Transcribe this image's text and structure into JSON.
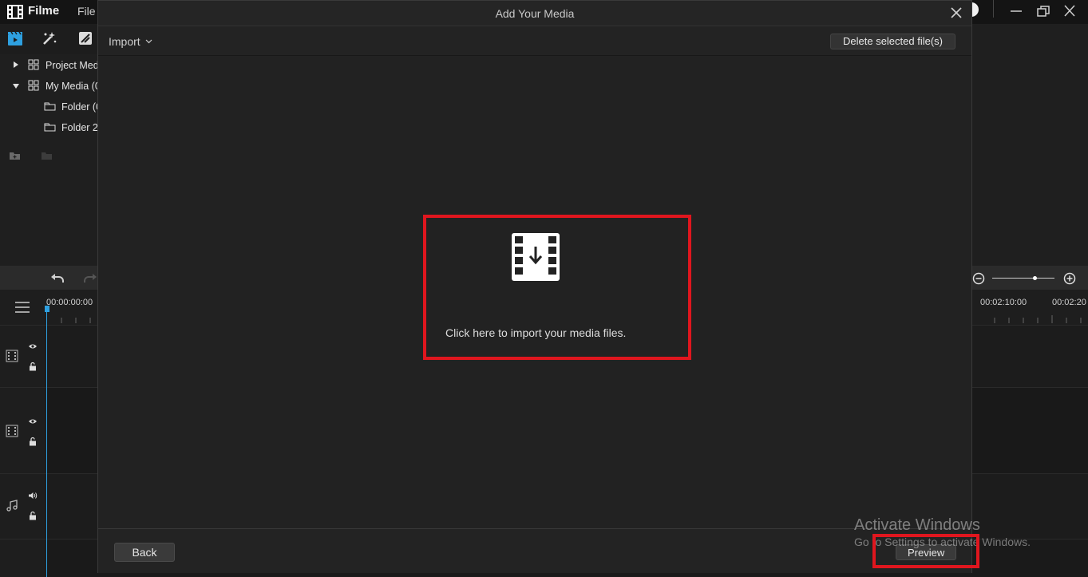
{
  "app": {
    "name": "Filme",
    "menu_file": "File"
  },
  "tree": {
    "items": [
      {
        "label": "Project Med",
        "type": "group"
      },
      {
        "label": "My Media (0",
        "type": "group"
      },
      {
        "label": "Folder (0",
        "type": "folder"
      },
      {
        "label": "Folder 2",
        "type": "folder"
      }
    ]
  },
  "timeline": {
    "start_time": "00:00:00:00",
    "time_a": "00:02:10:00",
    "time_b": "00:02:20"
  },
  "modal": {
    "title": "Add Your Media",
    "import_label": "Import",
    "delete_label": "Delete selected file(s)",
    "dropzone_text": "Click here to import your media files.",
    "back_label": "Back",
    "preview_label": "Preview"
  },
  "watermark": {
    "line1": "Activate Windows",
    "line2": "Go to Settings to activate Windows."
  },
  "colors": {
    "highlight": "#e0161e",
    "accent": "#2ea0e0"
  }
}
